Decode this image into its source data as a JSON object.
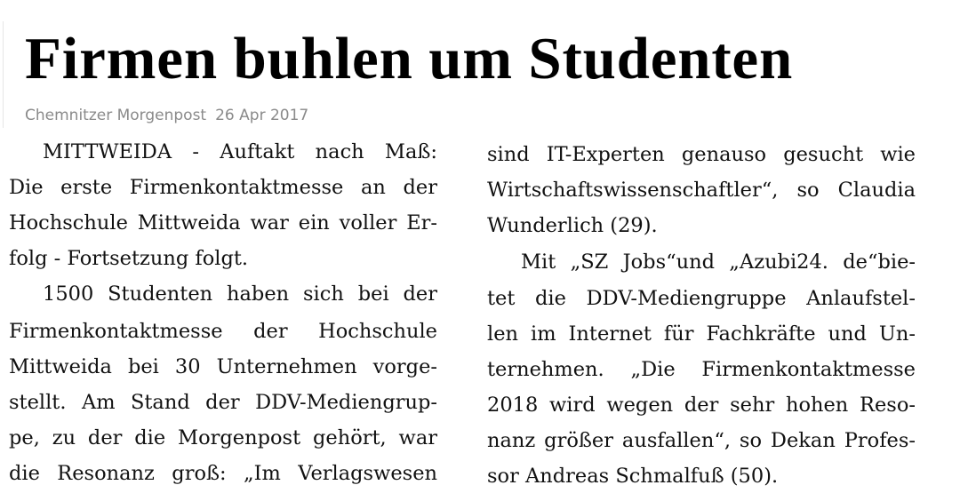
{
  "article": {
    "headline": "Firmen buhlen um Studenten",
    "source": "Chemnitzer Morgenpost",
    "date": "26 Apr 2017"
  },
  "columns": {
    "left": [
      "MITTWEIDA - Auftakt nach Maß:",
      "Die erste Firmenkontaktmesse an der",
      "Hochschule Mittweida war ein voller Er-",
      "folg - Fortsetzung folgt.",
      "1500 Studenten haben sich bei der",
      "Firmenkontaktmesse der Hochschule",
      "Mittweida bei 30 Unternehmen vorge-",
      "stellt. Am Stand der DDV-Mediengrup-",
      "pe, zu der die Morgenpost gehört, war",
      "die Resonanz groß: „Im Verlagswesen"
    ],
    "right": [
      "sind IT-Experten genauso gesucht wie",
      "Wirtschaftswissenschaftler“, so Claudia",
      "Wunderlich (29).",
      "Mit „SZ Jobs“und „Azubi24. de“bie-",
      "tet die DDV-Mediengruppe Anlaufstel-",
      "len im Internet für Fachkräfte und Un-",
      "ternehmen. „Die Firmenkontaktmesse",
      "2018 wird wegen der sehr hohen Reso-",
      "nanz größer ausfallen“, so Dekan Profes-",
      "sor Andreas Schmalfuß (50)."
    ]
  }
}
